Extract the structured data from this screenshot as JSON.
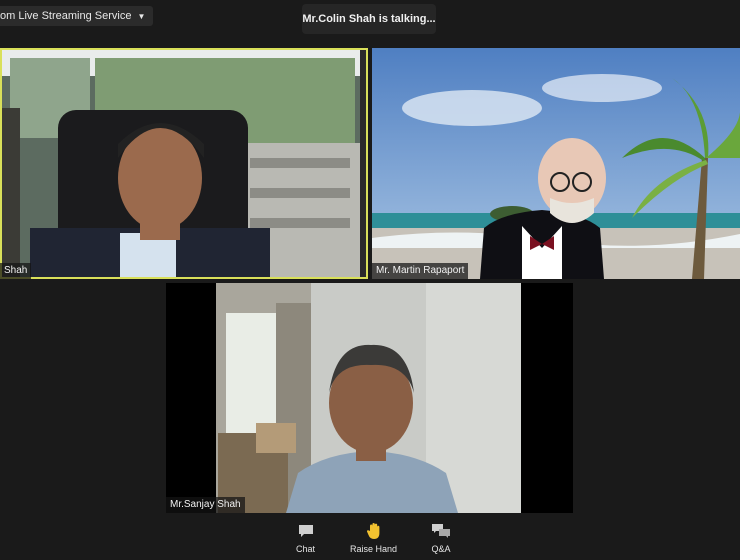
{
  "top_left_label": "om Live Streaming Service",
  "talking_indicator": "Mr.Colin Shah is talking...",
  "tiles": [
    {
      "name": "Shah"
    },
    {
      "name": "Mr. Martin Rapaport"
    },
    {
      "name": "Mr.Sanjay Shah"
    }
  ],
  "toolbar": {
    "chat": "Chat",
    "raise_hand": "Raise Hand",
    "qa": "Q&A"
  },
  "colors": {
    "active_speaker_border": "#d9e05a",
    "raise_hand_icon": "#f2c230"
  },
  "icons": [
    "chevron-down-icon",
    "chat-icon",
    "raise-hand-icon",
    "qa-icon"
  ]
}
